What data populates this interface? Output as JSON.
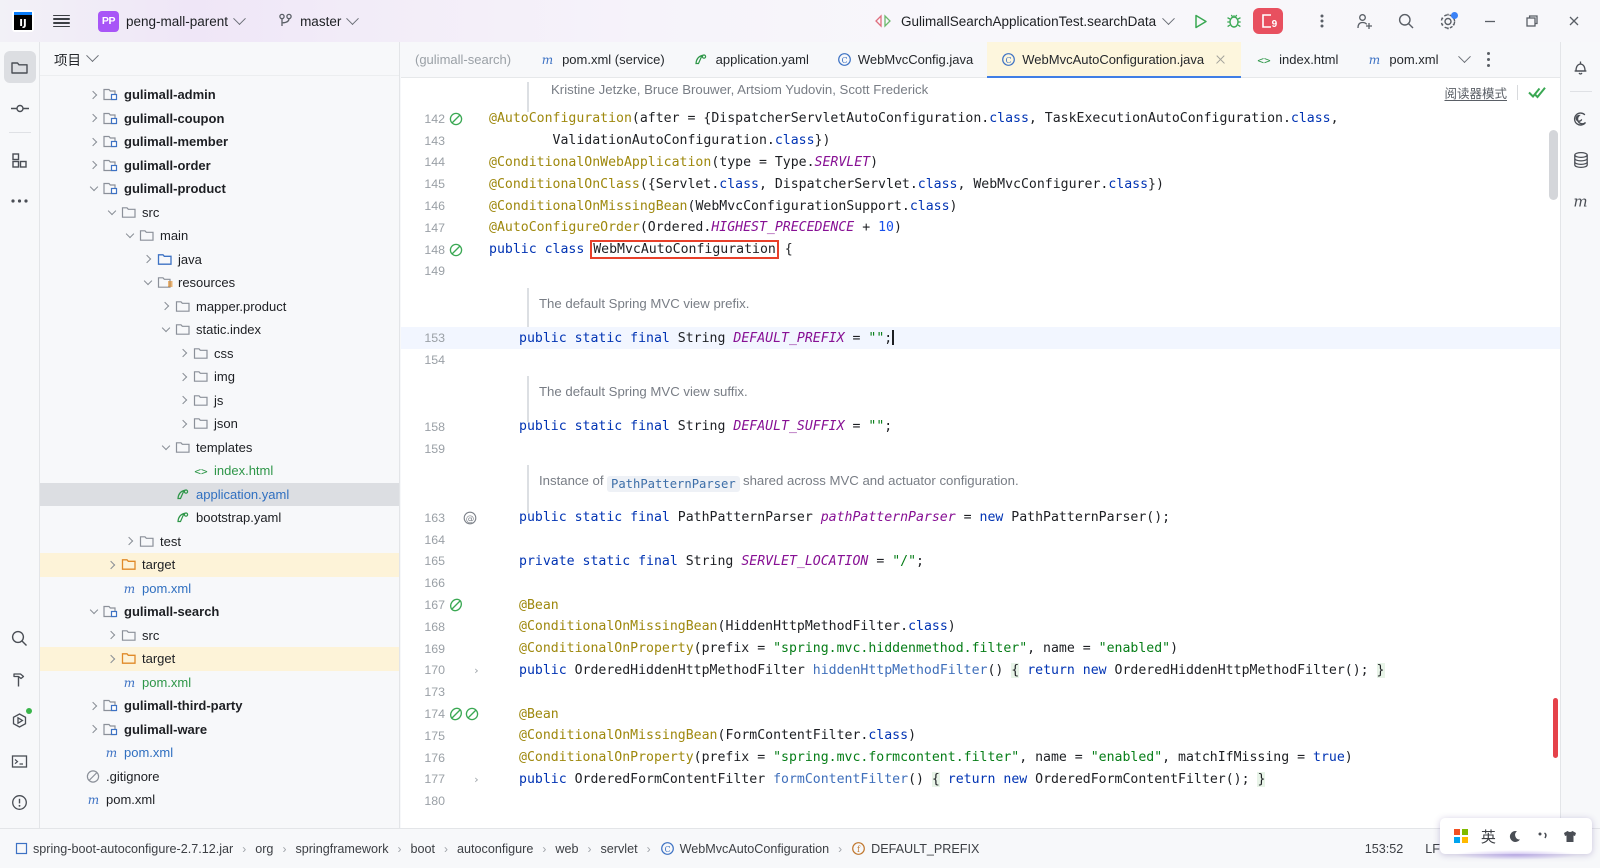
{
  "titlebar": {
    "project_name": "peng-mall-parent",
    "project_initials": "PP",
    "branch": "master",
    "run_config": "GulimallSearchApplicationTest.searchData",
    "stop_badge_count": "9",
    "icons": {
      "logo": "intellij-idea-logo",
      "menu": "hamburger-menu-icon",
      "vcs_branch": "git-branch-icon",
      "prev_next": "prev-next-occurrence-icon",
      "run": "run-icon",
      "debug": "debug-icon",
      "stop": "stop-process-icon",
      "more": "more-options-icon",
      "share": "add-collaborator-icon",
      "search": "search-everywhere-icon",
      "settings": "settings-gear-icon",
      "minimize": "minimize-window-icon",
      "maximize": "maximize-window-icon",
      "close": "close-window-icon"
    }
  },
  "rail_left": {
    "top": [
      {
        "name": "project-tool-window",
        "icon": "folder-icon",
        "active": true
      },
      {
        "name": "commit-tool-window",
        "icon": "commit-node-icon",
        "active": false
      },
      {
        "name": "structure-tool-window",
        "icon": "structure-blocks-icon",
        "active": false
      },
      {
        "name": "more-tool-windows",
        "icon": "ellipsis-icon",
        "active": false
      }
    ],
    "bottom": [
      {
        "name": "find-tool-window",
        "icon": "search-icon"
      },
      {
        "name": "build-tool-window",
        "icon": "hammer-icon"
      },
      {
        "name": "run-tool-window",
        "icon": "run-polygon-icon"
      },
      {
        "name": "terminal-tool-window",
        "icon": "terminal-icon"
      },
      {
        "name": "problems-tool-window",
        "icon": "warning-circle-icon"
      }
    ]
  },
  "rail_right": [
    {
      "name": "notifications",
      "icon": "bell-icon"
    },
    {
      "name": "spring-tool-window",
      "icon": "spring-spiral-icon"
    },
    {
      "name": "database-tool-window",
      "icon": "database-icon"
    },
    {
      "name": "maven-tool-window",
      "icon": "maven-m-icon"
    }
  ],
  "project_panel": {
    "title": "项目",
    "tree": [
      {
        "depth": 2,
        "twist": "right",
        "icon": "module-icon",
        "label": "gulimall-admin",
        "style": "mod"
      },
      {
        "depth": 2,
        "twist": "right",
        "icon": "module-icon",
        "label": "gulimall-coupon",
        "style": "mod"
      },
      {
        "depth": 2,
        "twist": "right",
        "icon": "module-icon",
        "label": "gulimall-member",
        "style": "mod"
      },
      {
        "depth": 2,
        "twist": "right",
        "icon": "module-icon",
        "label": "gulimall-order",
        "style": "mod"
      },
      {
        "depth": 2,
        "twist": "down",
        "icon": "module-icon",
        "label": "gulimall-product",
        "style": "mod"
      },
      {
        "depth": 3,
        "twist": "down",
        "icon": "folder-icon",
        "label": "src",
        "style": ""
      },
      {
        "depth": 4,
        "twist": "down",
        "icon": "folder-icon",
        "label": "main",
        "style": ""
      },
      {
        "depth": 5,
        "twist": "right",
        "icon": "source-root-icon",
        "label": "java",
        "style": ""
      },
      {
        "depth": 5,
        "twist": "down",
        "icon": "resource-root-icon",
        "label": "resources",
        "style": ""
      },
      {
        "depth": 6,
        "twist": "right",
        "icon": "folder-icon",
        "label": "mapper.product",
        "style": ""
      },
      {
        "depth": 6,
        "twist": "down",
        "icon": "folder-icon",
        "label": "static.index",
        "style": ""
      },
      {
        "depth": 7,
        "twist": "right",
        "icon": "folder-icon",
        "label": "css",
        "style": ""
      },
      {
        "depth": 7,
        "twist": "right",
        "icon": "folder-icon",
        "label": "img",
        "style": ""
      },
      {
        "depth": 7,
        "twist": "right",
        "icon": "folder-icon",
        "label": "js",
        "style": ""
      },
      {
        "depth": 7,
        "twist": "right",
        "icon": "folder-icon",
        "label": "json",
        "style": ""
      },
      {
        "depth": 6,
        "twist": "down",
        "icon": "folder-icon",
        "label": "templates",
        "style": ""
      },
      {
        "depth": 7,
        "twist": "none",
        "icon": "html-icon",
        "label": "index.html",
        "style": "green"
      },
      {
        "depth": 6,
        "twist": "none",
        "icon": "yaml-icon",
        "label": "application.yaml",
        "style": "blue",
        "state": "selected"
      },
      {
        "depth": 6,
        "twist": "none",
        "icon": "yaml-icon",
        "label": "bootstrap.yaml",
        "style": ""
      },
      {
        "depth": 4,
        "twist": "right",
        "icon": "folder-icon",
        "label": "test",
        "style": ""
      },
      {
        "depth": 3,
        "twist": "right",
        "icon": "target-folder-icon",
        "label": "target",
        "style": "",
        "state": "excluded"
      },
      {
        "depth": 3,
        "twist": "none",
        "icon": "maven-icon",
        "label": "pom.xml",
        "style": "blue"
      },
      {
        "depth": 2,
        "twist": "down",
        "icon": "module-icon",
        "label": "gulimall-search",
        "style": "mod"
      },
      {
        "depth": 3,
        "twist": "right",
        "icon": "folder-icon",
        "label": "src",
        "style": ""
      },
      {
        "depth": 3,
        "twist": "right",
        "icon": "target-folder-icon",
        "label": "target",
        "style": "",
        "state": "excluded"
      },
      {
        "depth": 3,
        "twist": "none",
        "icon": "maven-icon",
        "label": "pom.xml",
        "style": "green"
      },
      {
        "depth": 2,
        "twist": "right",
        "icon": "module-icon",
        "label": "gulimall-third-party",
        "style": "mod"
      },
      {
        "depth": 2,
        "twist": "right",
        "icon": "module-icon",
        "label": "gulimall-ware",
        "style": "mod"
      },
      {
        "depth": 2,
        "twist": "none",
        "icon": "maven-icon",
        "label": "pom.xml",
        "style": "blue"
      },
      {
        "depth": 1,
        "twist": "none",
        "icon": "gitignore-icon",
        "label": ".gitignore",
        "style": ""
      },
      {
        "depth": 1,
        "twist": "none",
        "icon": "maven-icon",
        "label": "pom.xml",
        "style": ""
      }
    ]
  },
  "editor": {
    "tabs": [
      {
        "label": "(gulimall-search)",
        "icon": "none",
        "active": false,
        "muted": true
      },
      {
        "label": "pom.xml (service)",
        "icon": "maven-icon",
        "active": false
      },
      {
        "label": "application.yaml",
        "icon": "yaml-icon",
        "active": false
      },
      {
        "label": "WebMvcConfig.java",
        "icon": "class-icon",
        "active": false
      },
      {
        "label": "WebMvcAutoConfiguration.java",
        "icon": "class-icon",
        "active": true,
        "closable": true
      },
      {
        "label": "index.html",
        "icon": "html-icon",
        "active": false
      },
      {
        "label": "pom.xml",
        "icon": "maven-icon",
        "active": false
      }
    ],
    "reader_mode_label": "阅读器模式",
    "authors_line": "Kristine Jetzke, Bruce Brouwer, Artsiom Yudovin, Scott Frederick",
    "doc_comments": {
      "prefix": "The default Spring MVC view prefix.",
      "suffix": "The default Spring MVC view suffix.",
      "parser_pre": "Instance of",
      "parser_chip": "PathPatternParser",
      "parser_post": "shared across MVC and actuator configuration."
    },
    "lines": [
      {
        "n": "142",
        "gutter": "bean-gutter-icon"
      },
      {
        "n": "143",
        "gutter": ""
      },
      {
        "n": "144",
        "gutter": ""
      },
      {
        "n": "145",
        "gutter": ""
      },
      {
        "n": "146",
        "gutter": ""
      },
      {
        "n": "147",
        "gutter": ""
      },
      {
        "n": "148",
        "gutter": "bean-gutter-icon"
      },
      {
        "n": "149",
        "gutter": ""
      },
      {
        "n": "153",
        "gutter": "",
        "current": true
      },
      {
        "n": "154",
        "gutter": ""
      },
      {
        "n": "158",
        "gutter": ""
      },
      {
        "n": "159",
        "gutter": ""
      },
      {
        "n": "163",
        "gutter": "at-gutter-icon"
      },
      {
        "n": "164",
        "gutter": ""
      },
      {
        "n": "165",
        "gutter": ""
      },
      {
        "n": "166",
        "gutter": ""
      },
      {
        "n": "167",
        "gutter": "bean-gutter-icon"
      },
      {
        "n": "168",
        "gutter": ""
      },
      {
        "n": "169",
        "gutter": ""
      },
      {
        "n": "170",
        "gutter": "",
        "fold": true
      },
      {
        "n": "173",
        "gutter": ""
      },
      {
        "n": "174",
        "gutter": "bean-gutter-icon-double"
      },
      {
        "n": "175",
        "gutter": ""
      },
      {
        "n": "176",
        "gutter": ""
      },
      {
        "n": "177",
        "gutter": "",
        "fold": true
      },
      {
        "n": "180",
        "gutter": ""
      }
    ],
    "highlighted_symbol": "WebMvcAutoConfiguration"
  },
  "statusbar": {
    "breadcrumbs": [
      {
        "label": "spring-boot-autoconfigure-2.7.12.jar",
        "icon": "jar-icon"
      },
      {
        "label": "org",
        "icon": ""
      },
      {
        "label": "springframework",
        "icon": ""
      },
      {
        "label": "boot",
        "icon": ""
      },
      {
        "label": "autoconfigure",
        "icon": ""
      },
      {
        "label": "web",
        "icon": ""
      },
      {
        "label": "servlet",
        "icon": ""
      },
      {
        "label": "WebMvcAutoConfiguration",
        "icon": "class-icon"
      },
      {
        "label": "DEFAULT_PREFIX",
        "icon": "field-icon"
      }
    ],
    "caret_position": "153:52",
    "line_separator": "LF"
  },
  "ime": {
    "items": [
      {
        "name": "windows-logo-icon",
        "label": ""
      },
      {
        "name": "input-mode-english",
        "label": "英"
      },
      {
        "name": "moon-icon",
        "label": ""
      },
      {
        "name": "punctuation-icon",
        "label": ""
      },
      {
        "name": "skin-icon",
        "label": ""
      }
    ]
  },
  "colors": {
    "accent_purple": "#a855f7",
    "tab_active": "#fdf6dd",
    "excluded_row": "#fdf3d8",
    "error_red": "#e8402a",
    "string_green": "#067d17",
    "keyword_blue": "#0033b3",
    "annotation_olive": "#9e880d",
    "constant_purple": "#871094"
  }
}
